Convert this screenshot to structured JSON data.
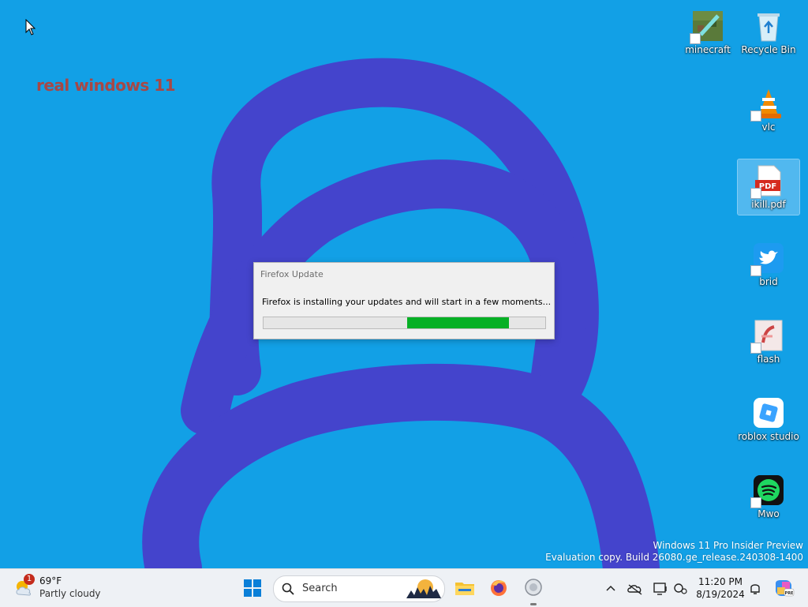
{
  "desktop": {
    "watermark_text": "real windows 11",
    "build_line1": "Windows 11 Pro Insider Preview",
    "build_line2": "Evaluation copy. Build 26080.ge_release.240308-1400",
    "icons": [
      {
        "label": "minecraft",
        "icon": "minecraft-icon"
      },
      {
        "label": "Recycle Bin",
        "icon": "recycle-bin-icon"
      },
      {
        "label": "vlc",
        "icon": "vlc-icon"
      },
      {
        "label": "ikill.pdf",
        "icon": "pdf-icon"
      },
      {
        "label": "brid",
        "icon": "twitter-bird-icon"
      },
      {
        "label": "flash",
        "icon": "flash-icon"
      },
      {
        "label": "roblox studio",
        "icon": "roblox-studio-icon"
      },
      {
        "label": "Mwo",
        "icon": "spotify-icon"
      }
    ]
  },
  "dialog": {
    "title": "Firefox Update",
    "message": "Firefox is installing your updates and will start in a few moments...",
    "progress_start": 0.51,
    "progress_end": 0.87,
    "progress_color": "#06b025"
  },
  "taskbar": {
    "weather_temp": "69°F",
    "weather_condition": "Partly cloudy",
    "weather_badge": "1",
    "search_placeholder": "Search",
    "clock_time": "11:20 PM",
    "clock_date": "8/19/2024",
    "apps": [
      "start-icon",
      "search-icon",
      "file-explorer-icon",
      "firefox-icon",
      "app-icon"
    ],
    "tray": [
      "chevron-up-icon",
      "onedrive-offline-icon",
      "display-icon",
      "accessibility-icon",
      "notifications-bell-icon",
      "copilot-icon"
    ]
  },
  "colors": {
    "wallpaper_blue": "#12a0e6",
    "scribble_blue": "#4444cc",
    "watermark_red": "#c0392b"
  }
}
